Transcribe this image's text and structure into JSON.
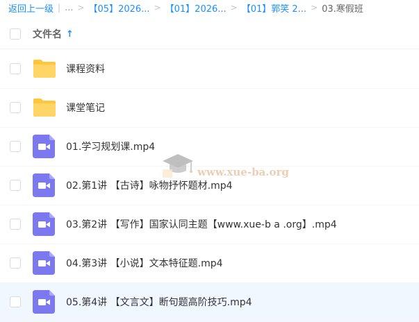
{
  "breadcrumb": {
    "back": "返回上一级",
    "divider": "|",
    "ellipsis": "...",
    "sep": ">",
    "items": [
      "【05】2026...",
      "【01】2026...",
      "【01】郭笑 2..."
    ],
    "current": "03.寒假班"
  },
  "list": {
    "header_label": "文件名",
    "sort_icon": "↑",
    "rows": [
      {
        "name": "课程资料",
        "type": "folder"
      },
      {
        "name": "课堂笔记",
        "type": "folder"
      },
      {
        "name": "01.学习规划课.mp4",
        "type": "video"
      },
      {
        "name": "02.第1讲 【古诗】咏物抒怀题材.mp4",
        "type": "video"
      },
      {
        "name": "03.第2讲 【写作】国家认同主题【www.xue-b a .org】.mp4",
        "type": "video"
      },
      {
        "name": "04.第3讲 【小说】文本特征题.mp4",
        "type": "video"
      },
      {
        "name": "05.第4讲 【文言文】断句题高阶技巧.mp4",
        "type": "video"
      }
    ]
  },
  "watermark": {
    "text": "www.xue-ba.org"
  },
  "colors": {
    "accent": "#1890ff",
    "folder": "#ffc53d",
    "video": "#7b78f0"
  }
}
